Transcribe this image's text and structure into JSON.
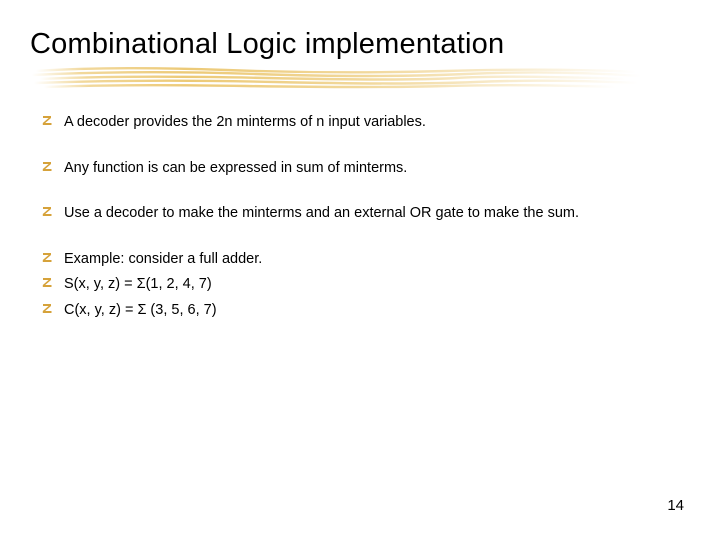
{
  "slide": {
    "title": "Combinational Logic implementation",
    "bullets": {
      "b1": "A decoder provides the 2n minterms of n input variables.",
      "b2": "Any function is can be expressed in sum of minterms.",
      "b3": "Use a decoder to make the minterms and an external OR gate to make the sum.",
      "b4": "Example: consider a full adder.",
      "b5": "S(x, y, z) = Σ(1, 2, 4, 7)",
      "b6": "C(x, y, z) = Σ (3, 5, 6, 7)"
    },
    "page_number": "14"
  }
}
